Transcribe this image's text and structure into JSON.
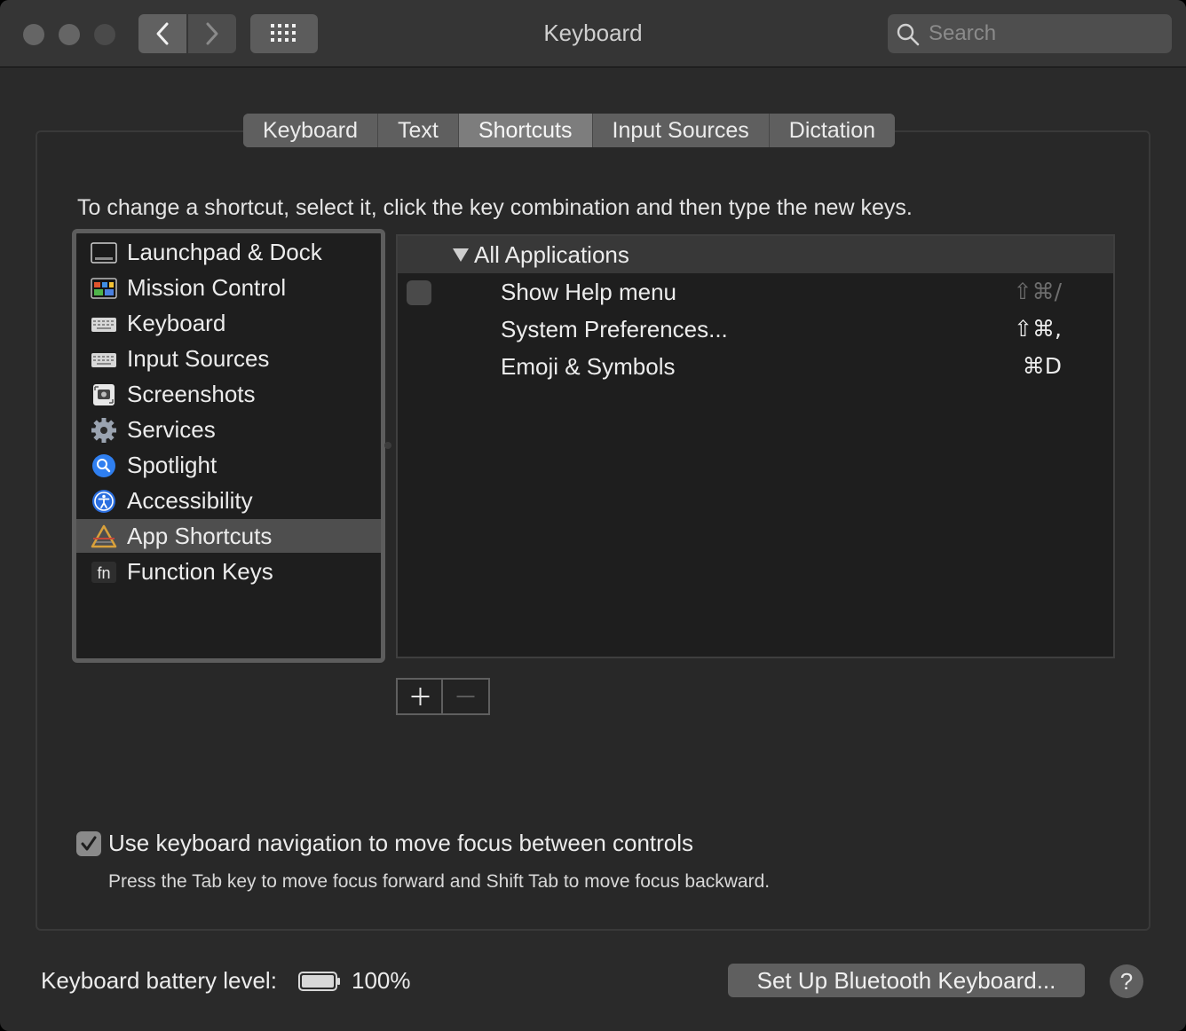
{
  "window": {
    "title": "Keyboard"
  },
  "search": {
    "placeholder": "Search",
    "value": ""
  },
  "tabs": [
    {
      "label": "Keyboard"
    },
    {
      "label": "Text"
    },
    {
      "label": "Shortcuts",
      "selected": true
    },
    {
      "label": "Input Sources"
    },
    {
      "label": "Dictation"
    }
  ],
  "instructions": "To change a shortcut, select it, click the key combination and then type the new keys.",
  "categories": [
    {
      "label": "Launchpad & Dock",
      "icon": "launchpad-dock-icon"
    },
    {
      "label": "Mission Control",
      "icon": "mission-control-icon"
    },
    {
      "label": "Keyboard",
      "icon": "keyboard-icon"
    },
    {
      "label": "Input Sources",
      "icon": "input-sources-icon"
    },
    {
      "label": "Screenshots",
      "icon": "screenshots-icon"
    },
    {
      "label": "Services",
      "icon": "gear-icon"
    },
    {
      "label": "Spotlight",
      "icon": "spotlight-icon"
    },
    {
      "label": "Accessibility",
      "icon": "accessibility-icon"
    },
    {
      "label": "App Shortcuts",
      "icon": "app-shortcuts-icon",
      "selected": true
    },
    {
      "label": "Function Keys",
      "icon": "fn-key-icon"
    }
  ],
  "shortcuts": {
    "group": "All Applications",
    "rows": [
      {
        "name": "Show Help menu",
        "keys": "⇧⌘/",
        "enabled": false
      },
      {
        "name": "System Preferences...",
        "keys": "⇧⌘,",
        "enabled": true
      },
      {
        "name": "Emoji & Symbols",
        "keys": "⌘D",
        "enabled": true
      }
    ]
  },
  "keyboard_navigation": {
    "checked": true,
    "label": "Use keyboard navigation to move focus between controls",
    "hint": "Press the Tab key to move focus forward and Shift Tab to move focus backward."
  },
  "footer": {
    "battery_label": "Keyboard battery level:",
    "battery_value": "100%",
    "battery_level": 1.0,
    "bluetooth_button": "Set Up Bluetooth Keyboard...",
    "help_label": "?"
  }
}
